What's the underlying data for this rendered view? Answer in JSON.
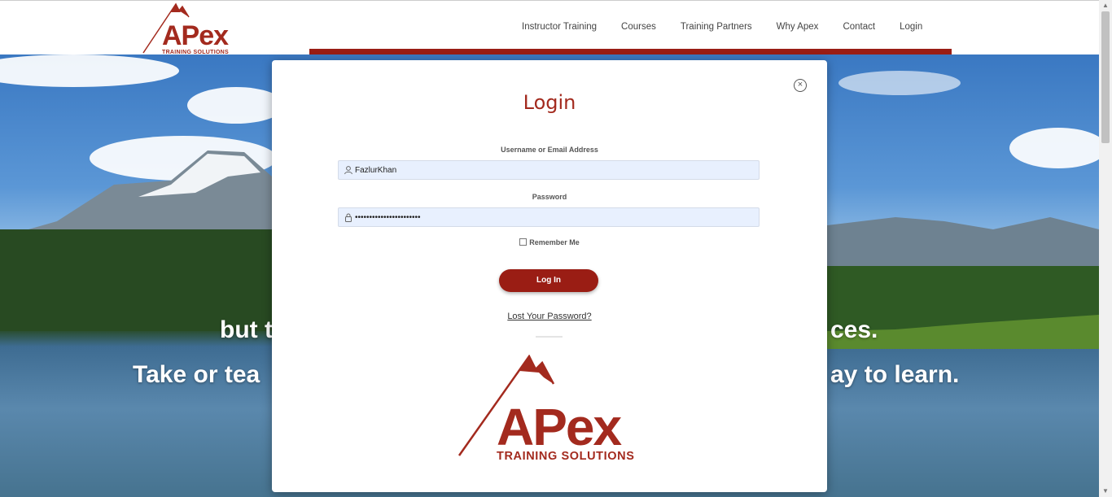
{
  "header": {
    "logo_text": "APex",
    "logo_sub": "TRAINING SOLUTIONS",
    "nav": [
      "Instructor Training",
      "Courses",
      "Training Partners",
      "Why Apex",
      "Contact",
      "Login"
    ]
  },
  "hero": {
    "line1_left": "but t",
    "line1_right": "ces.",
    "line2_left": "Take or tea",
    "line2_right": "ay to learn."
  },
  "modal": {
    "title": "Login",
    "username_label": "Username or Email Address",
    "username_value": "FazlurKhan",
    "password_label": "Password",
    "password_value": "•••••••••••••••••••••••",
    "remember_label": "Remember Me",
    "login_button": "Log In",
    "lost_password": "Lost Your Password?",
    "logo_text": "APex",
    "logo_sub": "TRAINING SOLUTIONS"
  },
  "colors": {
    "brand": "#a32a1e",
    "button": "#9a1d14",
    "field_bg": "#e8f0fe"
  }
}
